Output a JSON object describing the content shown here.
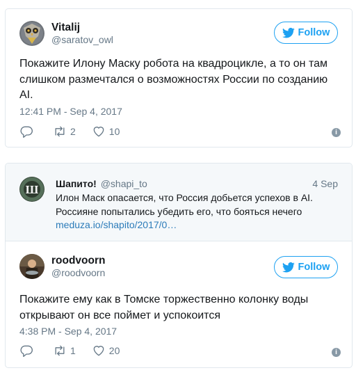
{
  "tweet1": {
    "name": "Vitalij",
    "handle": "@saratov_owl",
    "follow_label": "Follow",
    "text": "Покажите Илону Маску робота на квадроцикле, а то он там слишком размечтался о возможностях России по созданию AI.",
    "timestamp": "12:41 PM - Sep 4, 2017",
    "reply_count": "",
    "retweet_count": "2",
    "like_count": "10",
    "info_icon": "i"
  },
  "quoted": {
    "name": "Шапито!",
    "handle": "@shapi_to",
    "date": "4 Sep",
    "text": "Илон Маск опасается, что Россия добьется успехов в AI. Россияне попытались убедить его, что бояться нечего",
    "link": "meduza.io/shapito/2017/0…"
  },
  "tweet2": {
    "name": "roodvoorn",
    "handle": "@roodvoorn",
    "follow_label": "Follow",
    "text": "Покажите ему как в Томске торжественно колонку воды открывают он все поймет и успокоится",
    "timestamp": "4:38 PM - Sep 4, 2017",
    "reply_count": "",
    "retweet_count": "1",
    "like_count": "20",
    "info_icon": "i"
  },
  "colors": {
    "accent": "#1da1f2",
    "text": "#14171a",
    "secondary": "#657786",
    "border": "#e1e8ed",
    "quoted_bg": "#f5f8fa",
    "link": "#2b7bb9"
  },
  "icons": [
    "owl-avatar-icon",
    "shapito-logo-icon",
    "fish-avatar-icon",
    "twitter-bird-icon",
    "reply-icon",
    "retweet-icon",
    "like-icon",
    "info-icon"
  ]
}
